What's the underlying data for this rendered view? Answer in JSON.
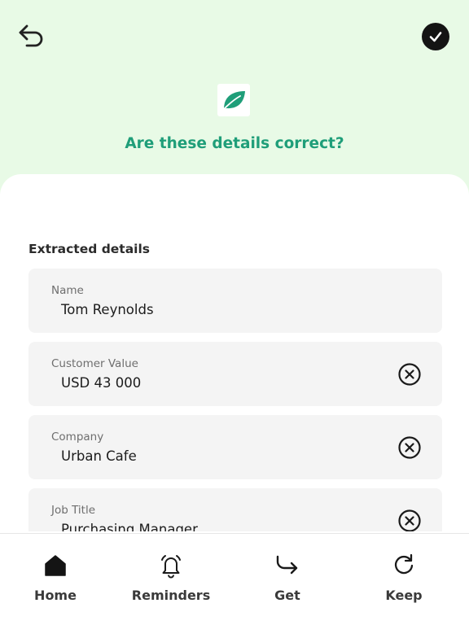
{
  "header": {
    "question": "Are these details correct?"
  },
  "extracted": {
    "section_title": "Extracted details",
    "fields": [
      {
        "label": "Name",
        "value": "Tom Reynolds"
      },
      {
        "label": "Customer Value",
        "value": "USD 43 000"
      },
      {
        "label": "Company",
        "value": "Urban Cafe"
      },
      {
        "label": "Job Title",
        "value": "Purchasing Manager"
      }
    ]
  },
  "nav": {
    "items": [
      {
        "label": "Home",
        "icon": "home-icon"
      },
      {
        "label": "Reminders",
        "icon": "bell-icon"
      },
      {
        "label": "Get",
        "icon": "redo-arrow-icon"
      },
      {
        "label": "Keep",
        "icon": "refresh-icon"
      }
    ]
  },
  "colors": {
    "header_bg": "#e8fae6",
    "accent": "#1f9e79",
    "confirm_bg": "#141414"
  }
}
